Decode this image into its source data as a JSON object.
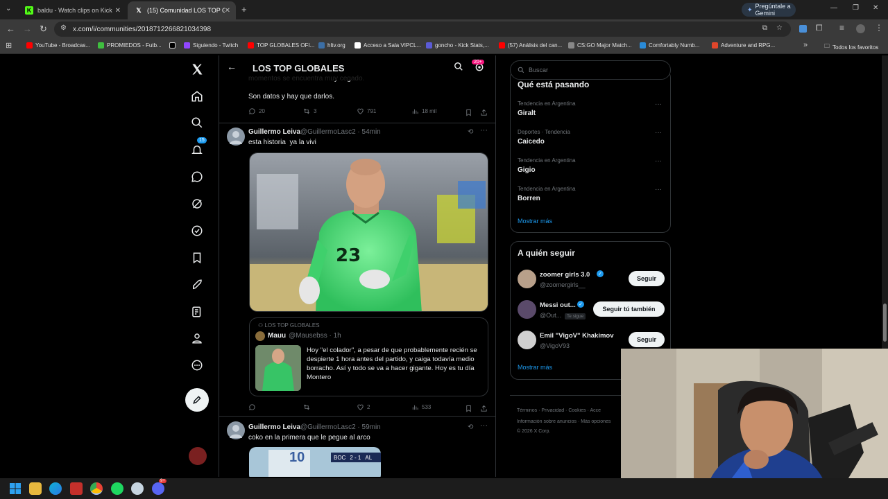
{
  "browser": {
    "tabs": [
      {
        "title": "baldu - Watch clips on Kick",
        "active": false,
        "favicon_color": "#53fc18"
      },
      {
        "title": "(15) Comunidad LOS TOP GLOBA",
        "active": true,
        "favicon_color": "#000000"
      }
    ],
    "gemini_label": "Pregúntale a Gemini",
    "url": "x.com/i/communities/2018712266821034398",
    "bookmarks": [
      {
        "label": "YouTube - Broadcas...",
        "color": "#ff0000"
      },
      {
        "label": "PROMIEDOS - Futb...",
        "color": "#3fbf3f"
      },
      {
        "label": "",
        "color": "#000000"
      },
      {
        "label": "Siguiendo - Twitch",
        "color": "#9146ff"
      },
      {
        "label": "TOP GLOBALES OFI...",
        "color": "#ff0000"
      },
      {
        "label": "hltv.org",
        "color": "#3b6ea5"
      },
      {
        "label": "Acceso a Sala VIPCL...",
        "color": "#ffffff"
      },
      {
        "label": "goncho - Kick Stats,...",
        "color": "#5b5bd6"
      },
      {
        "label": "(57) Análisis del can...",
        "color": "#ff0000"
      },
      {
        "label": "CS:GO Major Match...",
        "color": "#888888"
      },
      {
        "label": "Comfortably Numb...",
        "color": "#2a8bd8"
      },
      {
        "label": "Adventure and RPG...",
        "color": "#e0462b"
      }
    ],
    "all_bookmarks": "Todos los favoritos"
  },
  "x": {
    "notification_count": "15",
    "header": {
      "title": "LOS TOP GLOBALES",
      "badge": "20+"
    },
    "prev_post": {
      "line_partial": "momentos se encuentra muy cegado.",
      "text": "Son datos y hay que darlos.",
      "replies": "20",
      "reposts": "3",
      "likes": "791",
      "views": "18 mil"
    },
    "post1": {
      "name": "Guillermo Leiva",
      "handle": "@GuillermoLasc2 · 54min",
      "text": "esta historia  ya la vivi",
      "quote": {
        "community": "LOS TOP GLOBALES",
        "name": "Mauu",
        "handle": "@Mausebss · 1h",
        "text": "Hoy \"el colador\", a pesar de que probablemente recién se despierte 1 hora antes del partido, y caiga todavía medio borracho. Así y todo se va a hacer gigante. Hoy es tu día Montero"
      },
      "replies": "",
      "reposts": "",
      "likes": "2",
      "views": "533"
    },
    "post2": {
      "name": "Guillermo Leiva",
      "handle": "@GuillermoLasc2 · 59min",
      "text": "coko en la primera que le pegue al arco",
      "score_team": "BOC",
      "score": "2 - 1",
      "score_team2": "AL"
    },
    "search_placeholder": "Buscar",
    "trends": {
      "title": "Qué está pasando",
      "items": [
        {
          "context": "Tendencia en Argentina",
          "name": "Giralt"
        },
        {
          "context": "Deportes · Tendencia",
          "name": "Caicedo"
        },
        {
          "context": "Tendencia en Argentina",
          "name": "Gigio"
        },
        {
          "context": "Tendencia en Argentina",
          "name": "Borren"
        }
      ],
      "more": "Mostrar más"
    },
    "follow": {
      "title": "A quién seguir",
      "items": [
        {
          "name": "zoomer girls 3.0",
          "handle": "@zoomergirls__",
          "button": "Seguir",
          "follows_you": ""
        },
        {
          "name": "Messi out...",
          "handle": "@Out...",
          "button": "Seguir tú también",
          "follows_you": "Te sigue"
        },
        {
          "name": "Emil \"VigoV\" Khakimov",
          "handle": "@VigoV93",
          "button": "Seguir",
          "follows_you": ""
        }
      ],
      "more": "Mostrar más"
    },
    "footer": {
      "links": [
        "Términos",
        "Privacidad",
        "Cookies",
        "Acce"
      ],
      "line2": [
        "Información sobre anuncios",
        "Más opciones"
      ],
      "copyright": "© 2026 X Corp."
    },
    "jersey_number": "23"
  },
  "taskbar": {
    "apps": [
      "windows",
      "explorer",
      "edge",
      "twitch-app",
      "chrome",
      "spotify",
      "steam",
      "discord"
    ],
    "discord_badge": "9+"
  }
}
